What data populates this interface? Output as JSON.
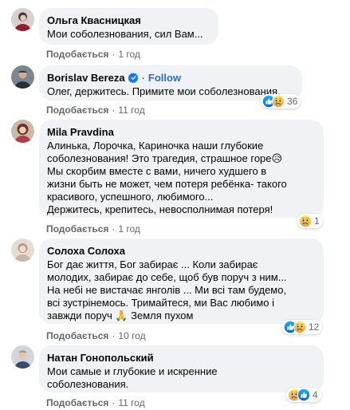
{
  "action_like": "Подобається",
  "separator": "·",
  "comments": [
    {
      "name": "Ольга Квасницкая",
      "text": "Мои соболезнования, сил Вам...",
      "time": "1 год",
      "reaction_count": ""
    },
    {
      "name": "Borislav Bereza",
      "follow": "Follow",
      "text": "Олег, держитесь. Примите мои соболезнования.",
      "time": "11 год",
      "reaction_count": "36",
      "reactions": [
        "like-icon",
        "sad-icon"
      ]
    },
    {
      "name": "Mila Pravdina",
      "text": "Алинька, Лорочка, Кариночка наши глубокие\nсоболезнования! Это трагедия, страшное горе😥\nМы скорбим вместе с вами, ничего худшего в\nжизни быть не может, чем потеря ребёнка- такого\nкрасивого, успешного, любимого...\nДержитесь, крепитесь, невосполнимая потеря!",
      "time": "1 год",
      "reaction_count": "1",
      "reactions": [
        "sad-icon"
      ]
    },
    {
      "name": "Солоха Солоха",
      "text": "Бог дає життя, Бог забирає ... Коли забирає\nмолодих, забирає до себе, щоб був поруч з ним...\nНа небі не вистачає янголів ... Ми всі там будемо,\nвсі зустрінемось. Тримайтеся, ми Вас любимо і\nзавжди поруч 🙏 Земля пухом",
      "time": "10 год",
      "reaction_count": "12",
      "reactions": [
        "like-icon",
        "sad-icon"
      ]
    },
    {
      "name": "Натан Гонопольский",
      "text": "Мои самые и глубокие и искренние\nсоболезнования.",
      "time": "11 год",
      "reaction_count": "4",
      "reactions": [
        "sad-icon",
        "like-icon"
      ]
    }
  ],
  "colors": {
    "bubble": "#f0f2f5",
    "link_blue": "#216fdb",
    "meta_gray": "#65676b",
    "like_blue": "#1877f2",
    "sad_yellow": "#f7b928"
  }
}
